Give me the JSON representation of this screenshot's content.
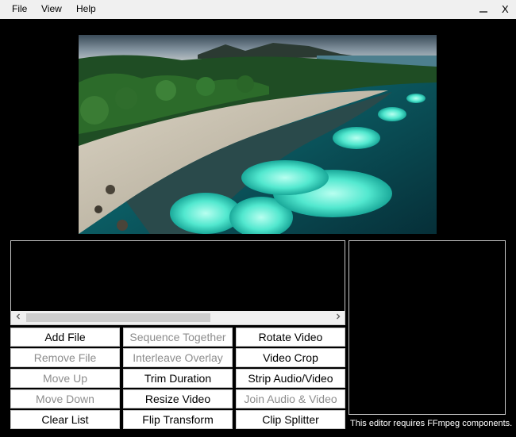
{
  "menu": {
    "file": "File",
    "view": "View",
    "help": "Help",
    "close": "X",
    "minimize_icon": "minimize-icon"
  },
  "preview": {
    "content": "aerial beach scene with turquoise water and palm trees"
  },
  "file_list": {
    "scroll_left_icon": "chevron-left-icon",
    "scroll_right_icon": "chevron-right-icon"
  },
  "buttons": {
    "col1": [
      {
        "label": "Add File",
        "enabled": true
      },
      {
        "label": "Remove File",
        "enabled": false
      },
      {
        "label": "Move Up",
        "enabled": false
      },
      {
        "label": "Move Down",
        "enabled": false
      },
      {
        "label": "Clear List",
        "enabled": true
      }
    ],
    "col2": [
      {
        "label": "Sequence Together",
        "enabled": false
      },
      {
        "label": "Interleave Overlay",
        "enabled": false
      },
      {
        "label": "Trim Duration",
        "enabled": true
      },
      {
        "label": "Resize Video",
        "enabled": true
      },
      {
        "label": "Flip Transform",
        "enabled": true
      }
    ],
    "col3": [
      {
        "label": "Rotate Video",
        "enabled": true
      },
      {
        "label": "Video Crop",
        "enabled": true
      },
      {
        "label": "Strip Audio/Video",
        "enabled": true
      },
      {
        "label": "Join Audio & Video",
        "enabled": false
      },
      {
        "label": "Clip Splitter",
        "enabled": true
      }
    ]
  },
  "status_text": "This editor requires FFmpeg components.",
  "colors": {
    "background": "#000000",
    "menubar": "#f0f0f0",
    "disabled_text": "#8d8d8d"
  }
}
